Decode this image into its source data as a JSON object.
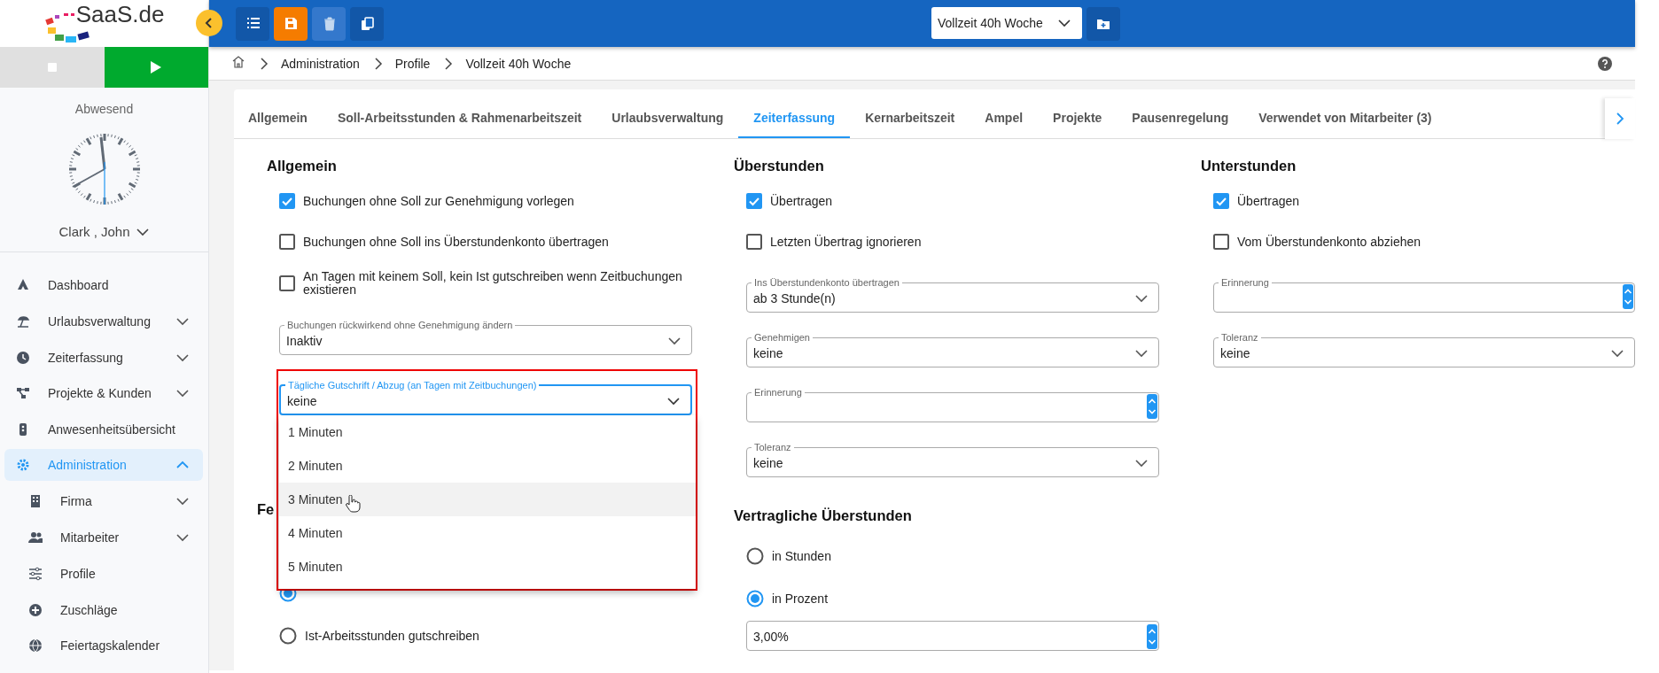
{
  "sidebar": {
    "logo_text": "SaaS.de",
    "status": "Abwesend",
    "user": "Clark , John",
    "nav": [
      {
        "label": "Dashboard",
        "kind": "link",
        "selected": false
      },
      {
        "label": "Urlaubsverwaltung",
        "kind": "group",
        "expanded": false,
        "selected": false
      },
      {
        "label": "Zeiterfassung",
        "kind": "group",
        "expanded": false,
        "selected": false
      },
      {
        "label": "Projekte & Kunden",
        "kind": "group",
        "expanded": false,
        "selected": false
      },
      {
        "label": "Anwesenheitsübersicht",
        "kind": "link",
        "selected": false
      },
      {
        "label": "Administration",
        "kind": "group",
        "expanded": true,
        "selected": true,
        "children": [
          {
            "label": "Firma",
            "kind": "group",
            "expanded": false,
            "selected": false
          },
          {
            "label": "Mitarbeiter",
            "kind": "group",
            "expanded": false,
            "selected": false
          },
          {
            "label": "Profile",
            "kind": "link",
            "selected": false
          },
          {
            "label": "Zuschläge",
            "kind": "link",
            "selected": false
          },
          {
            "label": "Feiertagskalender",
            "kind": "link",
            "selected": false
          }
        ]
      }
    ]
  },
  "toolbar": [
    {
      "highlighted": false,
      "disabled": false
    },
    {
      "highlighted": true,
      "disabled": false
    },
    {
      "highlighted": false,
      "disabled": true
    },
    {
      "highlighted": false,
      "disabled": false
    }
  ],
  "profile_select": {
    "value": "Vollzeit 40h Woche"
  },
  "breadcrumb": [
    "Administration",
    "Profile",
    "Vollzeit 40h Woche"
  ],
  "tabs": [
    {
      "label": "Allgemein",
      "selected": false
    },
    {
      "label": "Soll-Arbeitsstunden & Rahmenarbeitszeit",
      "selected": false
    },
    {
      "label": "Urlaubsverwaltung",
      "selected": false
    },
    {
      "label": "Zeiterfassung",
      "selected": true
    },
    {
      "label": "Kernarbeitszeit",
      "selected": false
    },
    {
      "label": "Ampel",
      "selected": false
    },
    {
      "label": "Projekte",
      "selected": false
    },
    {
      "label": "Pausenregelung",
      "selected": false
    },
    {
      "label": "Verwendet von Mitarbeiter (3)",
      "selected": false
    }
  ],
  "columns": [
    {
      "title": "Allgemein",
      "items": [
        {
          "kind": "checkbox",
          "label": "Buchungen ohne Soll zur Genehmigung vorlegen",
          "checked": true
        },
        {
          "kind": "checkbox",
          "label": "Buchungen ohne Soll ins Überstundenkonto übertragen",
          "checked": false
        },
        {
          "kind": "checkbox",
          "label": "An Tagen mit keinem Soll, kein Ist gutschreiben wenn Zeitbuchungen existieren",
          "checked": false
        },
        {
          "kind": "select",
          "label": "Buchungen rückwirkend ohne Genehmigung ändern",
          "value": "Inaktiv",
          "open": false
        },
        {
          "kind": "select",
          "label": "Tägliche Gutschrift / Abzug (an Tagen mit Zeitbuchungen)",
          "value": "keine",
          "open": true,
          "options": [
            {
              "label": "1 Minuten",
              "hovered": false
            },
            {
              "label": "2 Minuten",
              "hovered": false
            },
            {
              "label": "3 Minuten",
              "hovered": true
            },
            {
              "label": "4 Minuten",
              "hovered": false
            },
            {
              "label": "5 Minuten",
              "hovered": false
            }
          ]
        },
        {
          "kind": "heading",
          "label": "Fe"
        },
        {
          "kind": "radio",
          "selected": true
        },
        {
          "kind": "radio",
          "label": "Ist-Arbeitsstunden gutschreiben",
          "selected": false
        }
      ]
    },
    {
      "title": "Überstunden",
      "items": [
        {
          "kind": "checkbox",
          "label": "Übertragen",
          "checked": true
        },
        {
          "kind": "checkbox",
          "label": "Letzten Übertrag ignorieren",
          "checked": false
        },
        {
          "kind": "select",
          "label": "Ins Überstundenkonto übertragen",
          "value": "ab 3 Stunde(n)",
          "open": false
        },
        {
          "kind": "select",
          "label": "Genehmigen",
          "value": "keine",
          "open": false
        },
        {
          "kind": "number",
          "label": "Erinnerung"
        },
        {
          "kind": "select",
          "label": "Toleranz",
          "value": "keine",
          "open": false
        },
        {
          "kind": "heading",
          "label": "Vertragliche Überstunden"
        },
        {
          "kind": "radio",
          "label": "in Stunden",
          "selected": false
        },
        {
          "kind": "radio",
          "label": "in Prozent",
          "selected": true
        },
        {
          "kind": "number",
          "value": "3,00%"
        }
      ]
    },
    {
      "title": "Unterstunden",
      "items": [
        {
          "kind": "checkbox",
          "label": "Übertragen",
          "checked": true
        },
        {
          "kind": "checkbox",
          "label": "Vom Überstundenkonto abziehen",
          "checked": false
        },
        {
          "kind": "number",
          "label": "Erinnerung"
        },
        {
          "kind": "select",
          "label": "Toleranz",
          "value": "keine",
          "open": false
        }
      ]
    }
  ]
}
